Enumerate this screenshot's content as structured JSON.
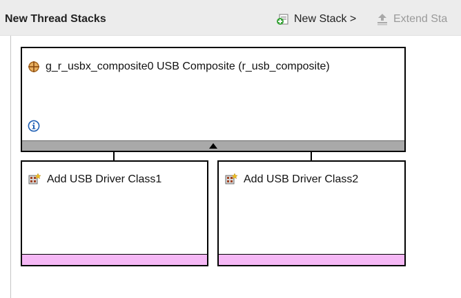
{
  "header": {
    "title": "New Thread Stacks",
    "new_stack_label": "New Stack >",
    "extend_stack_label": "Extend Sta"
  },
  "main_module": {
    "label": "g_r_usbx_composite0 USB Composite (r_usb_composite)",
    "icon": "module-crosshair-icon"
  },
  "children": [
    {
      "label": "Add USB Driver Class1",
      "icon": "add-module-icon"
    },
    {
      "label": "Add USB Driver Class2",
      "icon": "add-module-icon"
    }
  ],
  "colors": {
    "header_bg": "#ececec",
    "collapse_bar": "#a9a9a9",
    "child_footer": "#f5b8f5",
    "info_icon": "#1e5fb4",
    "module_icon": "#c8862a"
  }
}
